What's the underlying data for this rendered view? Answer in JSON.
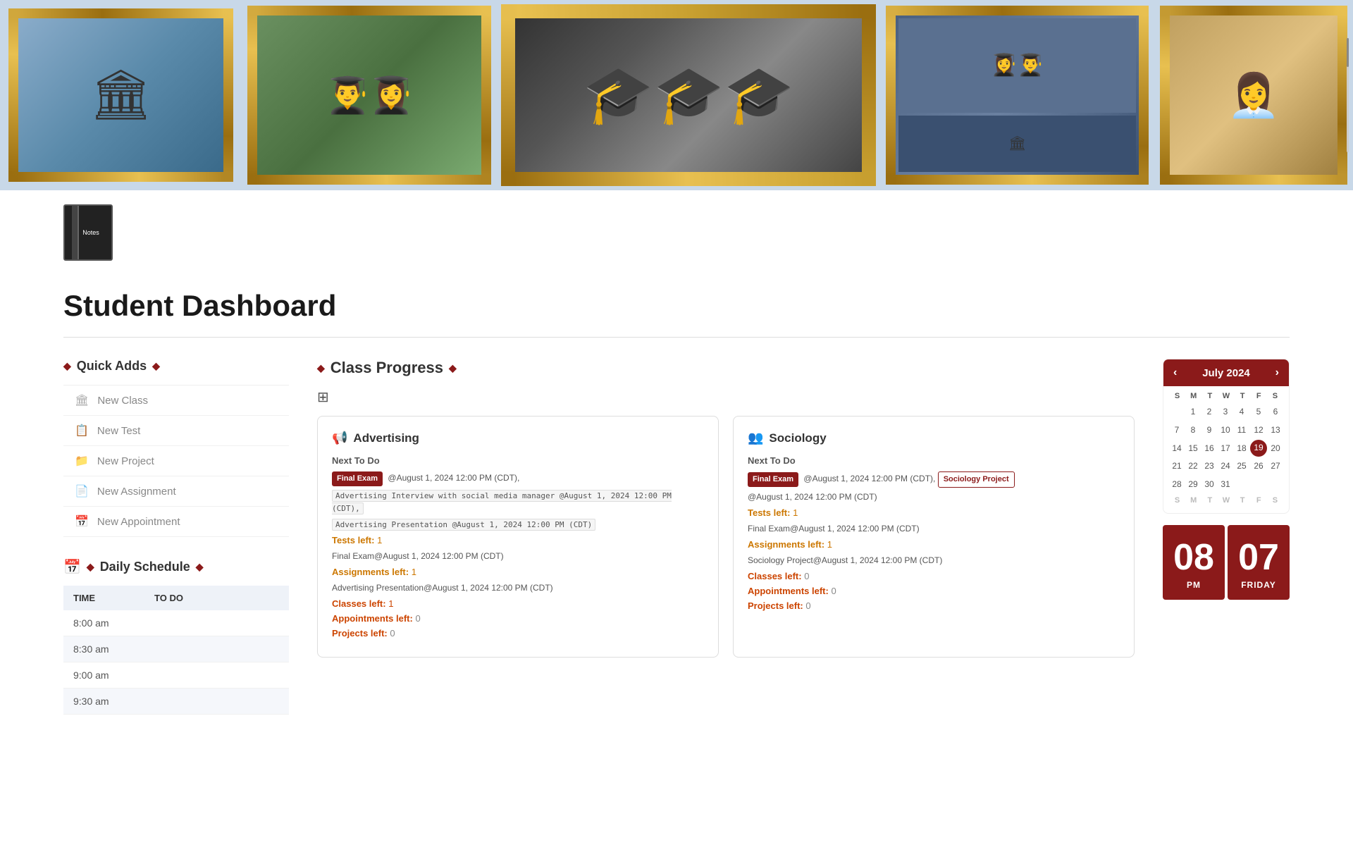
{
  "header": {
    "title": "Student Dashboard",
    "notebook_label": "Notes"
  },
  "quickAdds": {
    "section_title": "Quick Adds",
    "items": [
      {
        "id": "new-class",
        "icon": "🏛",
        "label": "New Class"
      },
      {
        "id": "new-test",
        "icon": "📋",
        "label": "New Test"
      },
      {
        "id": "new-project",
        "icon": "📁",
        "label": "New Project"
      },
      {
        "id": "new-assignment",
        "icon": "📄",
        "label": "New Assignment"
      },
      {
        "id": "new-appointment",
        "icon": "📅",
        "label": "New Appointment"
      }
    ]
  },
  "dailySchedule": {
    "section_title": "Daily Schedule",
    "columns": [
      "TIME",
      "TO DO"
    ],
    "rows": [
      {
        "time": "8:00 am",
        "todo": ""
      },
      {
        "time": "8:30 am",
        "todo": ""
      },
      {
        "time": "9:00 am",
        "todo": ""
      },
      {
        "time": "9:30 am",
        "todo": ""
      }
    ]
  },
  "classProgress": {
    "section_title": "Class Progress",
    "classes": [
      {
        "id": "advertising",
        "icon": "📢",
        "title": "Advertising",
        "nextToDo": "Next To Do",
        "badge": "Final Exam",
        "badge_date": "@August 1, 2024 12:00 PM (CDT),",
        "additional_entries": [
          "Advertising Interview with social media manager @August 1, 2024 12:00 PM (CDT),",
          "Advertising Presentation @August 1, 2024 12:00 PM (CDT)"
        ],
        "tests_left_label": "Tests left:",
        "tests_left_value": "1",
        "exam_line": "Final Exam@August 1, 2024 12:00 PM (CDT)",
        "assignments_left_label": "Assignments left:",
        "assignments_left_value": "1",
        "assignment_line": "Advertising Presentation@August 1, 2024 12:00 PM (CDT)",
        "classes_left_label": "Classes left:",
        "classes_left_value": "1",
        "appointments_left_label": "Appointments left:",
        "appointments_left_value": "0",
        "projects_left_label": "Projects left:",
        "projects_left_value": "0"
      },
      {
        "id": "sociology",
        "icon": "👥",
        "title": "Sociology",
        "nextToDo": "Next To Do",
        "badge": "Final Exam",
        "badge2": "Sociology Project",
        "badge_date": "@August 1, 2024 12:00 PM (CDT),",
        "badge2_date": "@August 1, 2024 12:00 PM (CDT)",
        "tests_left_label": "Tests left:",
        "tests_left_value": "1",
        "exam_line": "Final Exam@August 1, 2024 12:00 PM (CDT)",
        "assignments_left_label": "Assignments left:",
        "assignments_left_value": "1",
        "assignment_line": "Sociology Project@August 1, 2024 12:00 PM (CDT)",
        "classes_left_label": "Classes left:",
        "classes_left_value": "0",
        "appointments_left_label": "Appointments left:",
        "appointments_left_value": "0",
        "projects_left_label": "Projects left:",
        "projects_left_value": "0"
      }
    ]
  },
  "calendar": {
    "month_year": "July 2024",
    "day_headers": [
      "S",
      "M",
      "T",
      "W",
      "T",
      "F",
      "S"
    ],
    "today": 19,
    "weeks": [
      [
        null,
        1,
        2,
        3,
        4,
        5,
        6
      ],
      [
        7,
        8,
        9,
        10,
        11,
        12,
        13
      ],
      [
        14,
        15,
        16,
        17,
        18,
        19,
        20
      ],
      [
        21,
        22,
        23,
        24,
        25,
        26,
        27
      ],
      [
        28,
        29,
        30,
        31,
        null,
        null,
        null
      ]
    ]
  },
  "clock": {
    "hours": "08",
    "minutes": "07",
    "period": "PM",
    "day": "FRIDAY"
  }
}
